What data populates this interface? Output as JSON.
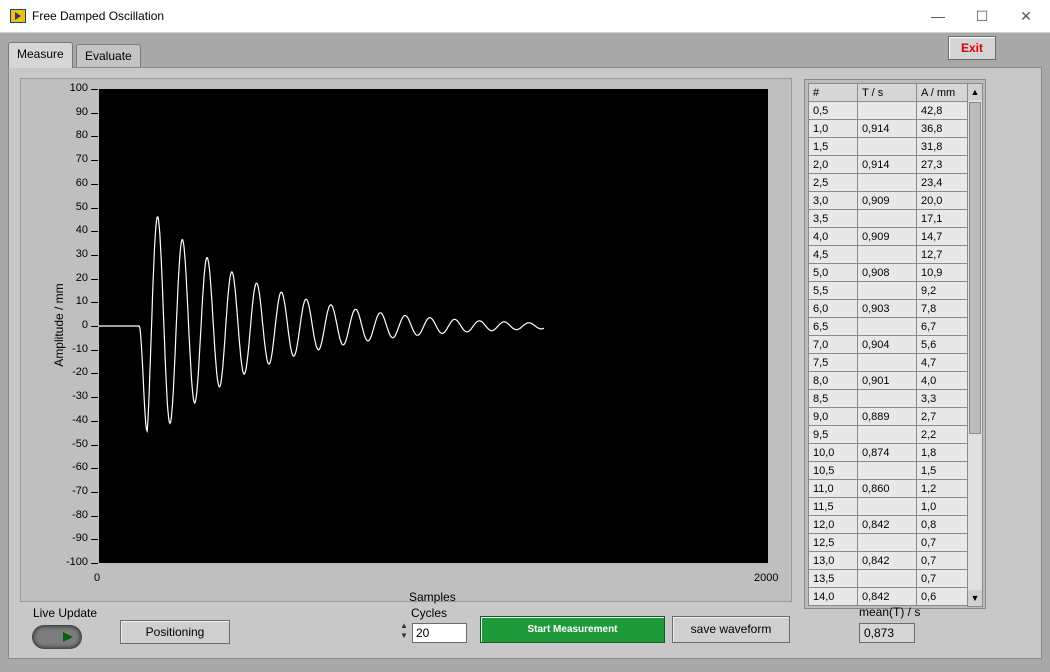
{
  "window": {
    "title": "Free Damped Oscillation",
    "min": "—",
    "max": "☐",
    "close": "✕"
  },
  "tabs": [
    {
      "label": "Measure"
    },
    {
      "label": "Evaluate"
    }
  ],
  "exit_label": "Exit",
  "chart_data": {
    "type": "line",
    "ylabel": "Amplitude / mm",
    "xlabel": "Samples",
    "xlim": [
      0,
      2000
    ],
    "ylim": [
      -100,
      100
    ],
    "yticks": [
      "100",
      "90",
      "80",
      "70",
      "60",
      "50",
      "40",
      "30",
      "20",
      "10",
      "0",
      "-10",
      "-20",
      "-30",
      "-40",
      "-50",
      "-60",
      "-70",
      "-80",
      "-90",
      "-100"
    ],
    "xticks": [
      "0",
      "2000"
    ],
    "signal": {
      "onset_sample": 120,
      "period_samples": 74,
      "first_min": -55,
      "first_max": 46,
      "decay": 0.8,
      "end_sample": 1330
    },
    "colors": {
      "line": "#ffffff",
      "plot_bg": "#000000"
    }
  },
  "table": {
    "headers": [
      "#",
      "T / s",
      "A / mm"
    ],
    "rows": [
      [
        "0,5",
        "",
        "42,8"
      ],
      [
        "1,0",
        "0,914",
        "36,8"
      ],
      [
        "1,5",
        "",
        "31,8"
      ],
      [
        "2,0",
        "0,914",
        "27,3"
      ],
      [
        "2,5",
        "",
        "23,4"
      ],
      [
        "3,0",
        "0,909",
        "20,0"
      ],
      [
        "3,5",
        "",
        "17,1"
      ],
      [
        "4,0",
        "0,909",
        "14,7"
      ],
      [
        "4,5",
        "",
        "12,7"
      ],
      [
        "5,0",
        "0,908",
        "10,9"
      ],
      [
        "5,5",
        "",
        "9,2"
      ],
      [
        "6,0",
        "0,903",
        "7,8"
      ],
      [
        "6,5",
        "",
        "6,7"
      ],
      [
        "7,0",
        "0,904",
        "5,6"
      ],
      [
        "7,5",
        "",
        "4,7"
      ],
      [
        "8,0",
        "0,901",
        "4,0"
      ],
      [
        "8,5",
        "",
        "3,3"
      ],
      [
        "9,0",
        "0,889",
        "2,7"
      ],
      [
        "9,5",
        "",
        "2,2"
      ],
      [
        "10,0",
        "0,874",
        "1,8"
      ],
      [
        "10,5",
        "",
        "1,5"
      ],
      [
        "11,0",
        "0,860",
        "1,2"
      ],
      [
        "11,5",
        "",
        "1,0"
      ],
      [
        "12,0",
        "0,842",
        "0,8"
      ],
      [
        "12,5",
        "",
        "0,7"
      ],
      [
        "13,0",
        "0,842",
        "0,7"
      ],
      [
        "13,5",
        "",
        "0,7"
      ],
      [
        "14,0",
        "0,842",
        "0,6"
      ]
    ]
  },
  "controls": {
    "live_update_label": "Live Update",
    "positioning_label": "Positioning",
    "cycles_label": "Cycles",
    "cycles_value": "20",
    "start_label": "Start Measurement",
    "save_label": "save waveform",
    "mean_label": "mean(T) / s",
    "mean_value": "0,873"
  }
}
